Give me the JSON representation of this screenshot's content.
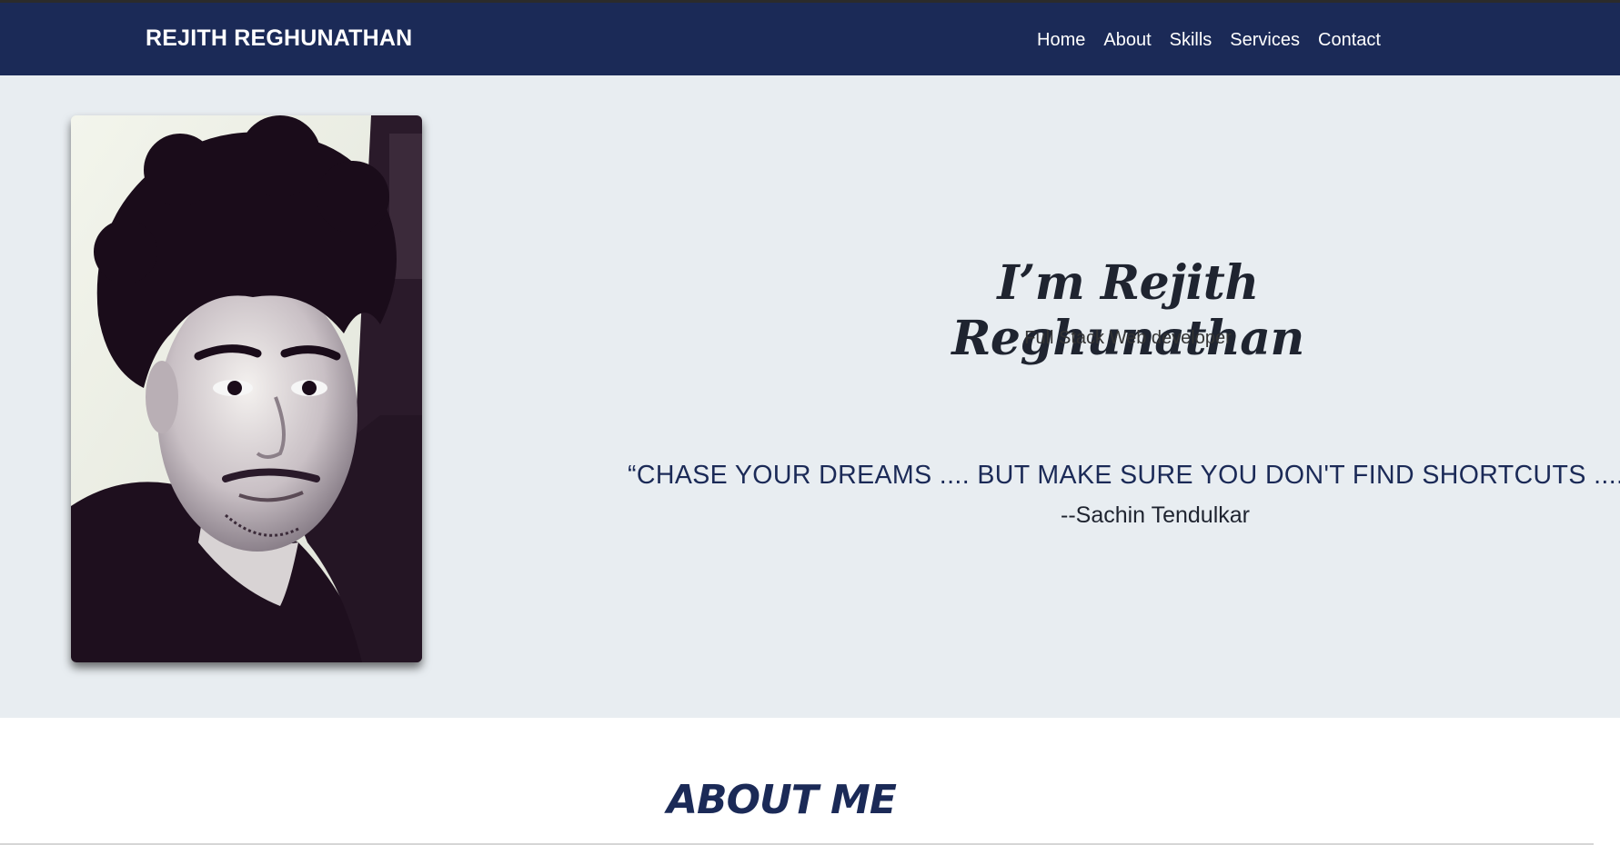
{
  "navbar": {
    "brand": "REJITH REGHUNATHAN",
    "links": [
      "Home",
      "About",
      "Skills",
      "Services",
      "Contact"
    ]
  },
  "hero": {
    "name": "I’m Rejith Reghunathan",
    "role": "Full Stack Web developer",
    "quote": "“CHASE YOUR DREAMS .... BUT MAKE SURE YOU DON'T FIND SHORTCUTS ....”",
    "author": "--Sachin Tendulkar"
  },
  "about": {
    "title": "ABOUT ME"
  },
  "colors": {
    "navbar_bg": "#1b2a57",
    "hero_bg": "#e8edf1",
    "accent_text": "#1b2a57"
  }
}
